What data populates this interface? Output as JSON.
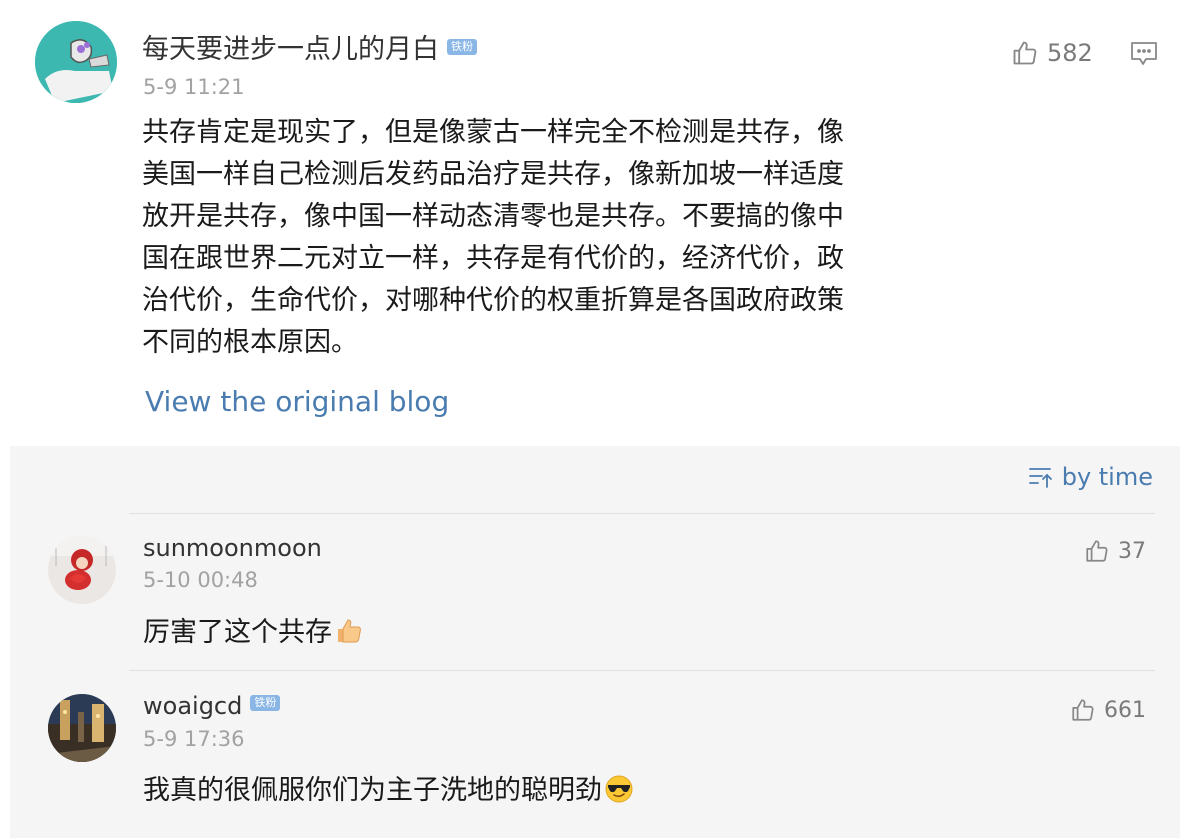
{
  "post": {
    "username": "每天要进步一点儿的月白",
    "badge": "铁粉",
    "time": "5-9 11:21",
    "likes": "582",
    "body": "共存肯定是现实了，但是像蒙古一样完全不检测是共存，像美国一样自己检测后发药品治疗是共存，像新加坡一样适度放开是共存，像中国一样动态清零也是共存。不要搞的像中国在跟世界二元对立一样，共存是有代价的，经济代价，政治代价，生命代价，对哪种代价的权重折算是各国政府政策不同的根本原因。",
    "view_link": "View the original blog",
    "icons": {
      "like": "thumbs-up-icon",
      "comment": "comment-icon"
    }
  },
  "comments_panel": {
    "sort_label": "by time",
    "sort_icon": "sort-icon",
    "comments": [
      {
        "username": "sunmoonmoon",
        "time": "5-10 00:48",
        "likes": "37",
        "text": "厉害了这个共存",
        "emoji": "thumbs-up-emoji"
      },
      {
        "username": "woaigcd",
        "badge": "铁粉",
        "time": "5-9 17:36",
        "likes": "661",
        "text": "我真的很佩服你们为主子洗地的聪明劲",
        "emoji": "sunglasses-emoji"
      }
    ]
  },
  "colors": {
    "link": "#4a7cb0",
    "badge": "#8ab6e6",
    "meta": "#a2a2a2",
    "panel_bg": "#f5f5f5"
  }
}
